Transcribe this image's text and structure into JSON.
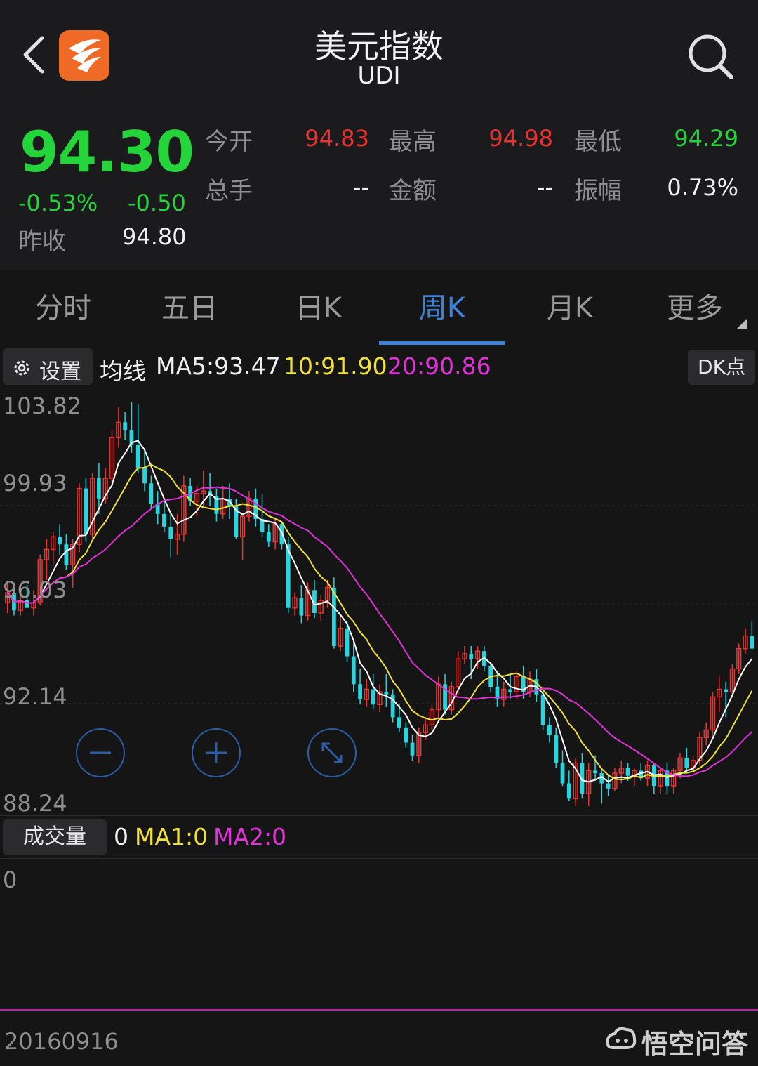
{
  "header": {
    "title": "美元指数",
    "code": "UDI"
  },
  "quote": {
    "price": "94.30",
    "change_pct": "-0.53%",
    "change_abs": "-0.50",
    "prev_close_label": "昨收",
    "prev_close": "94.80",
    "stats": [
      {
        "label": "今开",
        "value": "94.83",
        "color": "#e8332f"
      },
      {
        "label": "最高",
        "value": "94.98",
        "color": "#e8332f"
      },
      {
        "label": "最低",
        "value": "94.29",
        "color": "#25d33a"
      },
      {
        "label": "总手",
        "value": "--",
        "color": "#f0f0f0"
      },
      {
        "label": "金额",
        "value": "--",
        "color": "#f0f0f0"
      },
      {
        "label": "振幅",
        "value": "0.73%",
        "color": "#f0f0f0"
      }
    ]
  },
  "tabs": [
    {
      "label": "分时",
      "active": false
    },
    {
      "label": "五日",
      "active": false
    },
    {
      "label": "日K",
      "active": false
    },
    {
      "label": "周K",
      "active": true
    },
    {
      "label": "月K",
      "active": false
    },
    {
      "label": "更多",
      "active": false
    }
  ],
  "ma_bar": {
    "settings_label": "设置",
    "ma_title": "均线",
    "ma5": "MA5:93.47",
    "ma10": "10:91.90",
    "ma20": "20:90.86",
    "dk_label": "DK点"
  },
  "colors": {
    "up": "#e8332f",
    "down": "#27d5e0",
    "ma5": "#ffffff",
    "ma10": "#f0e03c",
    "ma20": "#e032d8",
    "accent": "#3c82d8"
  },
  "chart_data": {
    "type": "candlestick",
    "period": "周K",
    "y_ticks": [
      "103.82",
      "99.93",
      "96.03",
      "92.14",
      "88.24"
    ],
    "ylim": [
      88.24,
      103.82
    ],
    "ohlc": [
      [
        96.1,
        96.9,
        95.7,
        96.5
      ],
      [
        96.5,
        96.9,
        95.6,
        95.8
      ],
      [
        95.8,
        96.4,
        95.6,
        96.2
      ],
      [
        96.2,
        96.8,
        95.9,
        95.9
      ],
      [
        95.9,
        96.6,
        95.6,
        96.1
      ],
      [
        96.1,
        98.0,
        96.0,
        97.8
      ],
      [
        97.8,
        98.6,
        97.0,
        98.2
      ],
      [
        98.2,
        98.9,
        97.6,
        98.7
      ],
      [
        98.7,
        99.2,
        98.0,
        98.4
      ],
      [
        98.4,
        98.8,
        97.4,
        97.6
      ],
      [
        97.6,
        98.6,
        96.7,
        98.4
      ],
      [
        98.4,
        100.8,
        98.1,
        100.6
      ],
      [
        100.6,
        101.0,
        98.5,
        98.8
      ],
      [
        98.8,
        101.2,
        98.5,
        101.0
      ],
      [
        101.0,
        101.6,
        99.6,
        100.2
      ],
      [
        100.2,
        101.4,
        100.0,
        101.0
      ],
      [
        101.0,
        102.9,
        100.7,
        102.6
      ],
      [
        102.6,
        103.8,
        102.2,
        103.2
      ],
      [
        103.2,
        103.6,
        102.5,
        102.9
      ],
      [
        102.9,
        104.0,
        102.0,
        102.3
      ],
      [
        102.3,
        103.9,
        101.2,
        101.4
      ],
      [
        101.4,
        102.1,
        100.5,
        100.8
      ],
      [
        100.8,
        101.1,
        99.8,
        100.0
      ],
      [
        100.0,
        100.5,
        99.2,
        99.6
      ],
      [
        99.6,
        100.2,
        98.9,
        99.1
      ],
      [
        99.1,
        99.6,
        97.9,
        98.6
      ],
      [
        98.6,
        99.6,
        98.0,
        98.8
      ],
      [
        98.8,
        101.1,
        98.5,
        100.7
      ],
      [
        100.7,
        101.0,
        99.9,
        100.1
      ],
      [
        100.1,
        100.7,
        99.5,
        100.4
      ],
      [
        100.4,
        101.3,
        99.9,
        100.5
      ],
      [
        100.5,
        101.2,
        99.9,
        100.3
      ],
      [
        100.3,
        100.6,
        99.3,
        99.6
      ],
      [
        99.6,
        100.7,
        99.4,
        100.2
      ],
      [
        100.2,
        100.8,
        99.4,
        99.9
      ],
      [
        99.9,
        100.2,
        98.6,
        98.7
      ],
      [
        98.7,
        99.6,
        97.8,
        99.5
      ],
      [
        99.5,
        100.5,
        99.3,
        100.2
      ],
      [
        100.2,
        100.6,
        99.1,
        99.4
      ],
      [
        99.4,
        100.4,
        98.7,
        98.9
      ],
      [
        98.9,
        99.2,
        98.3,
        98.5
      ],
      [
        98.5,
        99.4,
        98.2,
        99.2
      ],
      [
        99.2,
        99.3,
        98.2,
        98.4
      ],
      [
        98.4,
        98.7,
        95.7,
        95.9
      ],
      [
        95.9,
        96.5,
        95.6,
        96.3
      ],
      [
        96.3,
        96.8,
        95.3,
        95.6
      ],
      [
        95.6,
        96.9,
        95.4,
        96.6
      ],
      [
        96.6,
        97.0,
        95.5,
        95.7
      ],
      [
        95.7,
        96.4,
        95.4,
        96.2
      ],
      [
        96.2,
        97.0,
        95.9,
        96.7
      ],
      [
        96.7,
        97.1,
        94.3,
        94.4
      ],
      [
        94.4,
        95.6,
        94.2,
        95.1
      ],
      [
        95.1,
        95.4,
        93.8,
        94.0
      ],
      [
        94.0,
        94.6,
        92.6,
        92.9
      ],
      [
        92.9,
        93.5,
        92.1,
        92.3
      ],
      [
        92.3,
        93.1,
        92.0,
        92.7
      ],
      [
        92.7,
        93.3,
        91.9,
        92.1
      ],
      [
        92.1,
        92.9,
        91.8,
        92.6
      ],
      [
        92.6,
        93.3,
        92.0,
        92.5
      ],
      [
        92.5,
        92.7,
        91.4,
        91.6
      ],
      [
        91.6,
        92.1,
        91.0,
        91.2
      ],
      [
        91.2,
        91.4,
        90.4,
        90.6
      ],
      [
        90.6,
        90.9,
        89.9,
        90.1
      ],
      [
        90.1,
        91.2,
        89.8,
        91.0
      ],
      [
        91.0,
        91.6,
        90.7,
        91.3
      ],
      [
        91.3,
        92.1,
        91.1,
        91.9
      ],
      [
        91.9,
        93.2,
        91.5,
        92.9
      ],
      [
        92.9,
        93.3,
        91.7,
        91.9
      ],
      [
        91.9,
        93.0,
        91.7,
        92.8
      ],
      [
        92.8,
        94.2,
        92.5,
        93.9
      ],
      [
        93.9,
        94.4,
        93.7,
        94.1
      ],
      [
        94.1,
        94.4,
        93.1,
        93.9
      ],
      [
        93.9,
        94.4,
        93.5,
        94.2
      ],
      [
        94.2,
        94.4,
        93.4,
        93.6
      ],
      [
        93.6,
        93.7,
        92.6,
        92.8
      ],
      [
        92.8,
        93.4,
        92.0,
        92.3
      ],
      [
        92.3,
        93.0,
        92.0,
        92.7
      ],
      [
        92.7,
        93.3,
        92.3,
        92.6
      ],
      [
        92.6,
        93.4,
        92.3,
        93.2
      ],
      [
        93.2,
        93.6,
        92.3,
        92.6
      ],
      [
        92.6,
        93.4,
        92.4,
        93.1
      ],
      [
        93.1,
        93.5,
        92.2,
        92.5
      ],
      [
        92.5,
        92.6,
        91.1,
        91.3
      ],
      [
        91.3,
        91.6,
        90.6,
        90.9
      ],
      [
        90.9,
        91.2,
        89.6,
        89.8
      ],
      [
        89.8,
        90.3,
        88.9,
        89.0
      ],
      [
        89.0,
        89.5,
        88.3,
        88.4
      ],
      [
        88.4,
        90.0,
        88.1,
        89.8
      ],
      [
        89.8,
        90.2,
        88.4,
        88.6
      ],
      [
        88.6,
        89.8,
        88.1,
        89.5
      ],
      [
        89.5,
        90.1,
        89.1,
        89.4
      ],
      [
        89.4,
        89.6,
        88.2,
        89.0
      ],
      [
        89.0,
        89.3,
        88.5,
        88.8
      ],
      [
        88.8,
        89.6,
        88.7,
        89.4
      ],
      [
        89.4,
        89.9,
        89.0,
        89.6
      ],
      [
        89.6,
        89.8,
        89.1,
        89.3
      ],
      [
        89.3,
        89.6,
        88.9,
        89.5
      ],
      [
        89.5,
        89.8,
        89.1,
        89.2
      ],
      [
        89.2,
        89.9,
        88.9,
        89.7
      ],
      [
        89.7,
        89.8,
        88.6,
        88.9
      ],
      [
        88.9,
        89.6,
        88.6,
        89.5
      ],
      [
        89.5,
        89.8,
        88.6,
        88.9
      ],
      [
        88.9,
        89.6,
        88.6,
        89.5
      ],
      [
        89.5,
        90.2,
        89.2,
        90.0
      ],
      [
        90.0,
        90.4,
        89.4,
        89.6
      ],
      [
        89.6,
        90.1,
        89.4,
        89.9
      ],
      [
        89.9,
        91.0,
        89.7,
        90.8
      ],
      [
        90.8,
        91.4,
        90.5,
        91.1
      ],
      [
        91.1,
        92.6,
        90.8,
        92.4
      ],
      [
        92.4,
        93.2,
        91.8,
        92.7
      ],
      [
        92.7,
        93.0,
        91.6,
        92.6
      ],
      [
        92.6,
        93.7,
        92.5,
        93.5
      ],
      [
        93.5,
        94.5,
        93.3,
        94.3
      ],
      [
        94.3,
        95.1,
        94.1,
        94.8
      ],
      [
        94.8,
        95.4,
        94.4,
        94.3
      ]
    ]
  },
  "zoom_controls": {
    "zoom_out": "minus-icon",
    "zoom_in": "plus-icon",
    "fullscreen": "expand-icon"
  },
  "volume_bar": {
    "label": "成交量",
    "value": "0",
    "ma1": "MA1:0",
    "ma2": "MA2:0",
    "axis_zero": "0"
  },
  "footer": {
    "date": "20160916",
    "watermark": "悟空问答"
  }
}
